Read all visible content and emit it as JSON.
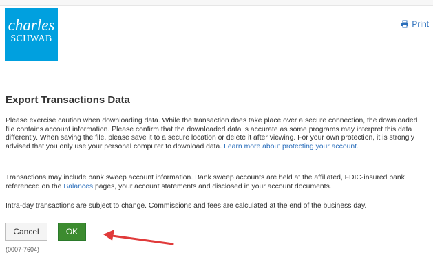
{
  "header": {
    "logo_line1": "charles",
    "logo_line2": "SCHWAB",
    "print_label": "Print"
  },
  "content": {
    "title": "Export Transactions Data",
    "p1_text": "Please exercise caution when downloading data. While the transaction does take place over a secure connection, the downloaded file contains account information. Please confirm that the downloaded data is accurate as some programs may interpret this data differently. When saving the file, please save it to a secure location or delete it after viewing. For your own protection, it is strongly advised that you only use your personal computer to download data.",
    "p1_link": "Learn more about protecting your account.",
    "p2_before": "Transactions may include bank sweep account information. Bank sweep accounts are held at the affiliated, FDIC-insured bank referenced on the ",
    "p2_link": "Balances",
    "p2_after": " pages, your account statements and disclosed in your account documents.",
    "p3_text": "Intra-day transactions are subject to change. Commissions and fees are calculated at the end of the business day."
  },
  "actions": {
    "cancel_label": "Cancel",
    "ok_label": "OK"
  },
  "footer": {
    "ref_code": "(0007-7604)"
  },
  "colors": {
    "brand": "#00a0df",
    "link": "#2a6ebb",
    "ok_button": "#3c8b2f",
    "annotation_arrow": "#e03a3a"
  },
  "icons": {
    "print": "printer-icon",
    "annotation": "red-arrow-annotation"
  }
}
